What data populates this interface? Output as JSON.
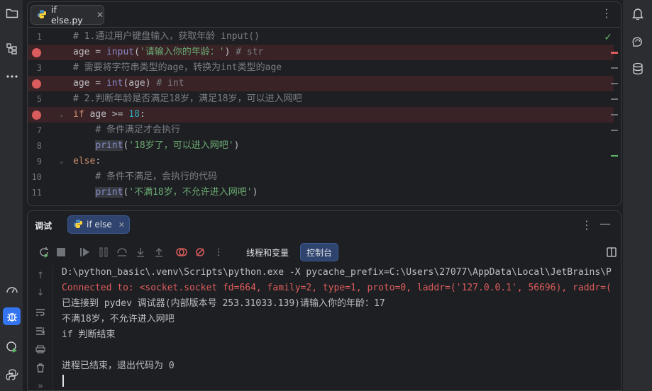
{
  "editor": {
    "file_tab": "if else.py",
    "tab_close": "✕",
    "more": "⋮",
    "lines": [
      {
        "n": "1",
        "bp": false,
        "fold": "",
        "code": [
          {
            "t": "# 1.通过用户键盘输入，获取年龄 input()",
            "c": "c-com"
          }
        ]
      },
      {
        "n": "",
        "bp": true,
        "fold": "",
        "code": [
          {
            "t": "age = ",
            "c": "c-txt"
          },
          {
            "t": "input",
            "c": "c-bi"
          },
          {
            "t": "(",
            "c": "c-txt"
          },
          {
            "t": "'请输入你的年龄：'",
            "c": "c-str"
          },
          {
            "t": ") ",
            "c": "c-txt"
          },
          {
            "t": "# str",
            "c": "c-com"
          }
        ]
      },
      {
        "n": "3",
        "bp": false,
        "fold": "",
        "code": [
          {
            "t": "# 需要将字符串类型的age，转换为int类型的age",
            "c": "c-com"
          }
        ]
      },
      {
        "n": "",
        "bp": true,
        "fold": "",
        "code": [
          {
            "t": "age = ",
            "c": "c-txt"
          },
          {
            "t": "int",
            "c": "c-bi"
          },
          {
            "t": "(age) ",
            "c": "c-txt"
          },
          {
            "t": "# int",
            "c": "c-com"
          }
        ]
      },
      {
        "n": "5",
        "bp": false,
        "fold": "",
        "code": [
          {
            "t": "# 2.判断年龄是否满足18岁，满足18岁，可以进入网吧",
            "c": "c-com"
          }
        ]
      },
      {
        "n": "",
        "bp": true,
        "fold": "⌄",
        "code": [
          {
            "t": "if",
            "c": "c-kw"
          },
          {
            "t": " age >= ",
            "c": "c-txt"
          },
          {
            "t": "18",
            "c": "c-num"
          },
          {
            "t": ":",
            "c": "c-txt"
          }
        ]
      },
      {
        "n": "7",
        "bp": false,
        "fold": "",
        "code": [
          {
            "t": "    ",
            "c": "c-txt"
          },
          {
            "t": "# 条件满足才会执行",
            "c": "c-com"
          }
        ]
      },
      {
        "n": "8",
        "bp": false,
        "fold": "",
        "code": [
          {
            "t": "    ",
            "c": "c-txt"
          },
          {
            "t": "print",
            "c": "hl-print"
          },
          {
            "t": "(",
            "c": "c-txt"
          },
          {
            "t": "'18岁了，可以进入网吧'",
            "c": "c-str"
          },
          {
            "t": ")",
            "c": "c-txt"
          }
        ]
      },
      {
        "n": "9",
        "bp": false,
        "fold": "⌄",
        "code": [
          {
            "t": "else",
            "c": "c-kw"
          },
          {
            "t": ":",
            "c": "c-txt"
          }
        ]
      },
      {
        "n": "10",
        "bp": false,
        "fold": "",
        "code": [
          {
            "t": "    ",
            "c": "c-txt"
          },
          {
            "t": "# 条件不满足，会执行的代码",
            "c": "c-com"
          }
        ]
      },
      {
        "n": "11",
        "bp": false,
        "fold": "",
        "code": [
          {
            "t": "    ",
            "c": "c-txt"
          },
          {
            "t": "print",
            "c": "hl-print"
          },
          {
            "t": "(",
            "c": "c-txt"
          },
          {
            "t": "'不满18岁，不允许进入网吧'",
            "c": "c-str"
          },
          {
            "t": ")",
            "c": "c-txt"
          }
        ]
      }
    ]
  },
  "debug": {
    "title": "调试",
    "tab": "if else",
    "tab_close": "✕",
    "more": "⋮",
    "minimize": "—",
    "sub_tabs": {
      "threads": "线程和变量",
      "console": "控制台"
    },
    "console_lines": [
      {
        "t": "D:\\python_basic\\.venv\\Scripts\\python.exe -X pycache_prefix=C:\\Users\\27077\\AppData\\Local\\JetBrains\\P",
        "err": false
      },
      {
        "t": "Connected to: <socket.socket fd=664, family=2, type=1, proto=0, laddr=('127.0.0.1', 56696), raddr=(",
        "err": true
      },
      {
        "t": "已连接到 pydev 调试器(内部版本号 253.31033.139)请输入你的年龄：17",
        "err": false
      },
      {
        "t": "不满18岁，不允许进入网吧",
        "err": false
      },
      {
        "t": "if 判断结束",
        "err": false
      },
      {
        "t": "",
        "err": false
      },
      {
        "t": "进程已结束，退出代码为 0",
        "err": false
      }
    ]
  },
  "colors": {
    "accent": "#3574f0",
    "breakpoint": "#db5c5c",
    "string": "#6aab73",
    "keyword": "#cf8e6d"
  },
  "icons": [
    "folder-icon",
    "structure-icon",
    "more-icon",
    "performance-icon",
    "debug-icon",
    "run-coverage-icon",
    "python-console-icon",
    "notifications-icon",
    "ai-assistant-icon",
    "database-icon",
    "python-file-icon"
  ]
}
